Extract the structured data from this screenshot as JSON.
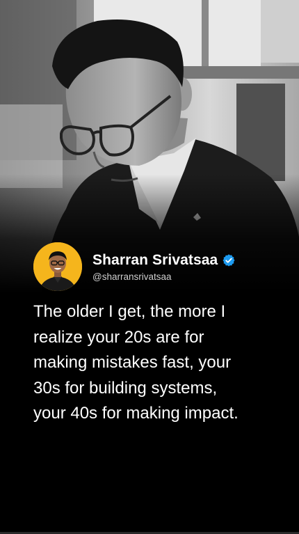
{
  "post": {
    "author": {
      "name": "Sharran Srivatsaa",
      "handle": "@sharransrivatsaa",
      "verified": true,
      "avatar_bg": "#f5b51c"
    },
    "quote_lines": [
      "The older I get, the more I",
      "realize your 20s are for",
      "making mistakes fast, your",
      "30s for building systems,",
      "your 40s for making impact."
    ],
    "photo": {
      "style": "black-and-white portrait"
    },
    "colors": {
      "background": "#000000",
      "verified_badge": "#1d9bf0",
      "text": "#ffffff"
    },
    "icons": {
      "verified": "verified-check-icon"
    }
  }
}
